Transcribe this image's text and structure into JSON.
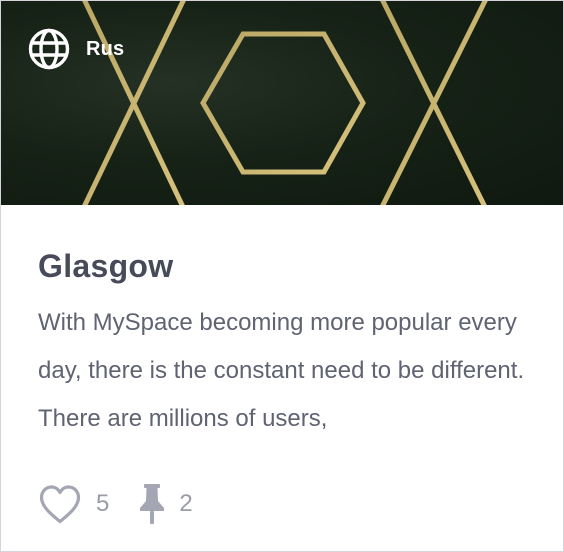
{
  "card": {
    "language": {
      "icon": "globe-icon",
      "label": "Rus"
    },
    "title": "Glasgow",
    "description": "With MySpace becoming more popular every day, there is the constant need to be different. There are millions of users,",
    "stats": {
      "likes": {
        "icon": "heart-icon",
        "count": "5"
      },
      "pins": {
        "icon": "pushpin-icon",
        "count": "2"
      }
    }
  },
  "colors": {
    "banner_background": "#172217",
    "pattern_gold": "#c8b46c",
    "title_text": "#474b59",
    "body_text": "#5f6372",
    "stat_text": "#9a9ca8"
  }
}
